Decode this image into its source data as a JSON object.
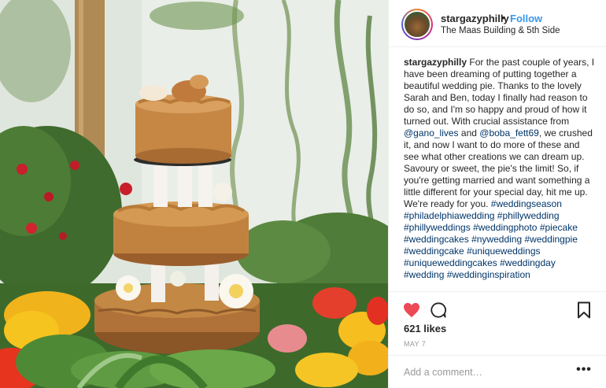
{
  "post": {
    "username": "stargazyphilly",
    "separator": "•",
    "follow_label": "Follow",
    "location": "The Maas Building & 5th Side"
  },
  "caption": {
    "username": "stargazyphilly",
    "text_1": " For the past couple of years, I have been dreaming of putting together a beautiful wedding pie. Thanks to the lovely Sarah and Ben, today I finally had reason to do so, and I'm so happy and proud of how it turned out. With crucial assistance from ",
    "mention_1": "@gano_lives",
    "text_2": " and ",
    "mention_2": "@boba_fett69",
    "text_3": ", we crushed it, and now I want to do more of these and see what other creations we can dream up. Savoury or sweet, the pie's the limit! So, if you're getting married and want something a little different for your special day, hit me up. We're ready for you. ",
    "hashtags": [
      "#weddingseason",
      "#philadelphiawedding",
      "#phillywedding",
      "#phillyweddings",
      "#weddingphoto",
      "#piecake",
      "#weddingcakes",
      "#nywedding",
      "#weddingpie",
      "#weddingcake",
      "#uniqueweddings",
      "#uniqueweddingcakes",
      "#weddingday",
      "#wedding",
      "#weddinginspiration"
    ]
  },
  "actions": {
    "likes": "621 likes",
    "date": "MAY 7",
    "comment_placeholder": "Add a comment…",
    "more_label": "•••"
  },
  "icons": {
    "heart": "heart-icon",
    "comment": "comment-icon",
    "bookmark": "bookmark-icon"
  },
  "colors": {
    "link": "#3897f0",
    "hashtag": "#003569",
    "heart": "#ed4956"
  }
}
